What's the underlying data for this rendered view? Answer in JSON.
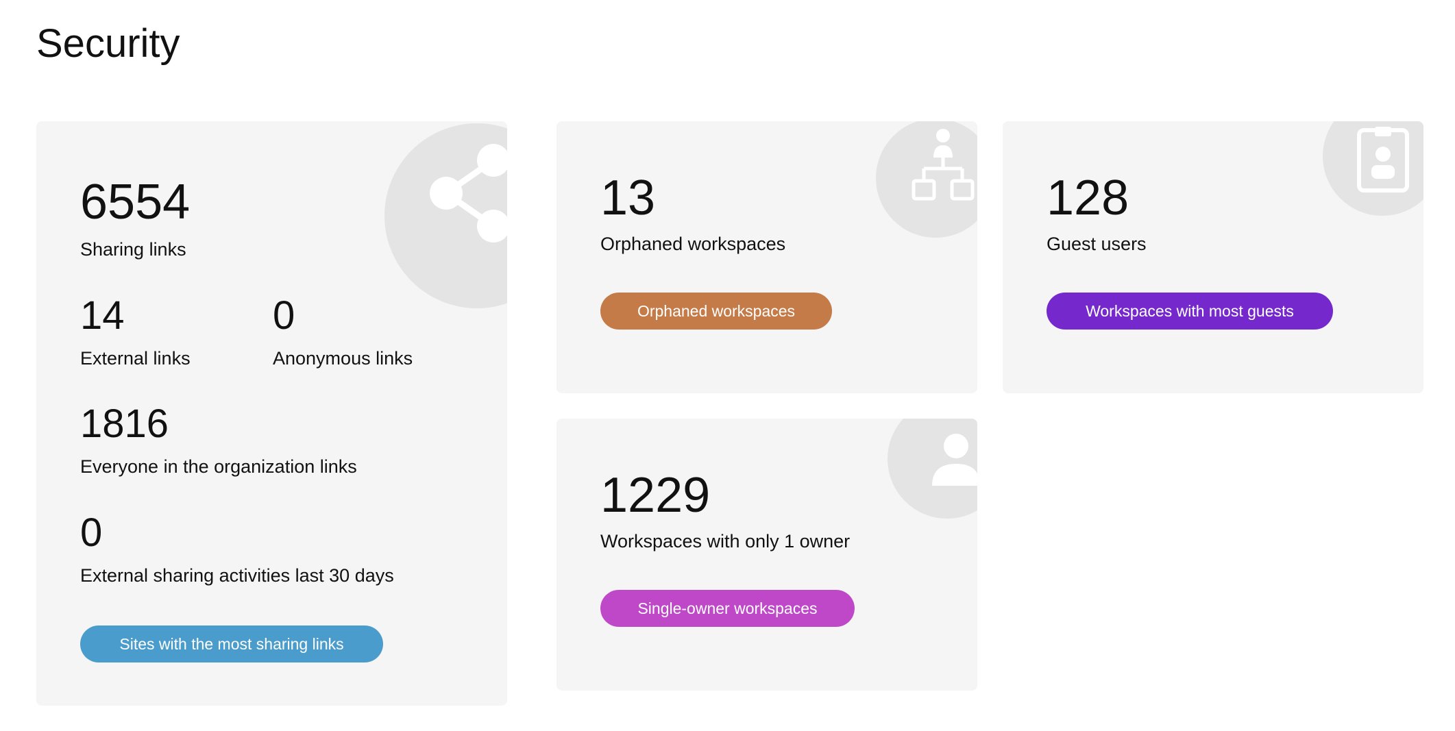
{
  "page": {
    "title": "Security"
  },
  "sharing": {
    "icon": "share-icon",
    "total_value": "6554",
    "total_label": "Sharing links",
    "external_value": "14",
    "external_label": "External links",
    "anonymous_value": "0",
    "anonymous_label": "Anonymous links",
    "org_value": "1816",
    "org_label": "Everyone in the organization links",
    "activity_value": "0",
    "activity_label": "External sharing activities last 30 days",
    "button_label": "Sites with the most sharing links",
    "button_color": "#4a9ccc"
  },
  "orphaned": {
    "icon": "hierarchy-icon",
    "value": "13",
    "label": "Orphaned workspaces",
    "button_label": "Orphaned workspaces",
    "button_color": "#c47b48"
  },
  "guests": {
    "icon": "badge-icon",
    "value": "128",
    "label": "Guest users",
    "button_label": "Workspaces with most guests",
    "button_color": "#7529cc"
  },
  "single_owner": {
    "icon": "person-icon",
    "value": "1229",
    "label": "Workspaces with only 1 owner",
    "button_label": "Single-owner workspaces",
    "button_color": "#bf48c9"
  },
  "colors": {
    "card_background": "#f5f5f5",
    "icon_circle": "#e4e4e4",
    "icon_glyph": "#ffffff"
  }
}
